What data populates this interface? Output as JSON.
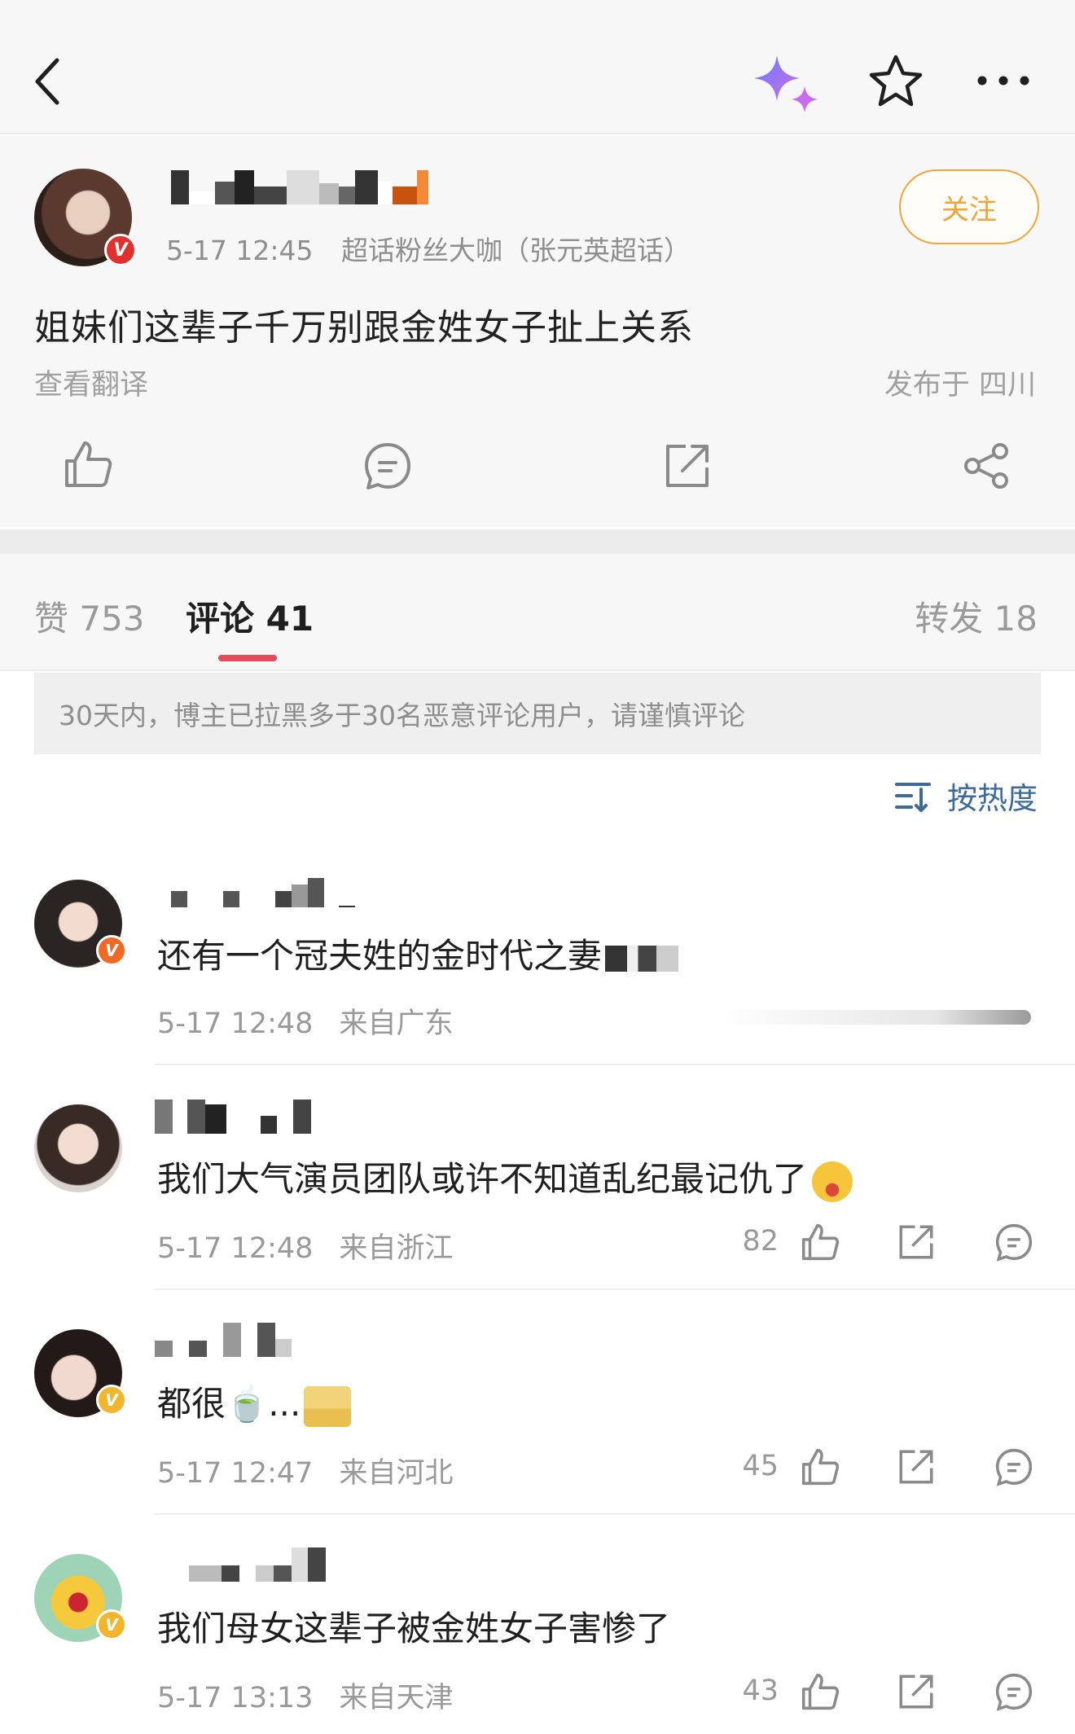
{
  "topbar": {
    "icons": [
      "back-icon",
      "sparkle-icon",
      "star-icon",
      "more-icon"
    ]
  },
  "post": {
    "time": "5-17 12:45",
    "source": "超话粉丝大咖（张元英超话）",
    "follow_label": "关注",
    "text": "姐妹们这辈子千万别跟金姓女子扯上关系",
    "translate_label": "查看翻译",
    "location": "发布于 四川",
    "badge_color": "#e0312f",
    "action_icons": [
      "like-icon",
      "comment-icon",
      "repost-icon",
      "share-icon"
    ]
  },
  "tabs": {
    "likes": "赞 753",
    "comments": "评论 41",
    "reposts": "转发 18"
  },
  "notice": "30天内，博主已拉黑多于30名恶意评论用户，请谨慎评论",
  "sort_label": "按热度",
  "comments": [
    {
      "text": "还有一个冠夫姓的金时代之妻",
      "time": "5-17 12:48",
      "location": "来自广东",
      "likes": "",
      "badge_color": "#f06a26"
    },
    {
      "text": "我们大气演员团队或许不知道乱纪最记仇了",
      "time": "5-17 12:48",
      "location": "来自浙江",
      "likes": "82",
      "badge_color": "#f06a26"
    },
    {
      "text": "都很🍵...",
      "time": "5-17 12:47",
      "location": "来自河北",
      "likes": "45",
      "badge_color": "#f3b52c"
    },
    {
      "text": "我们母女这辈子被金姓女子害惨了",
      "time": "5-17 13:13",
      "location": "来自天津",
      "likes": "43",
      "badge_color": "#f3b52c"
    }
  ]
}
